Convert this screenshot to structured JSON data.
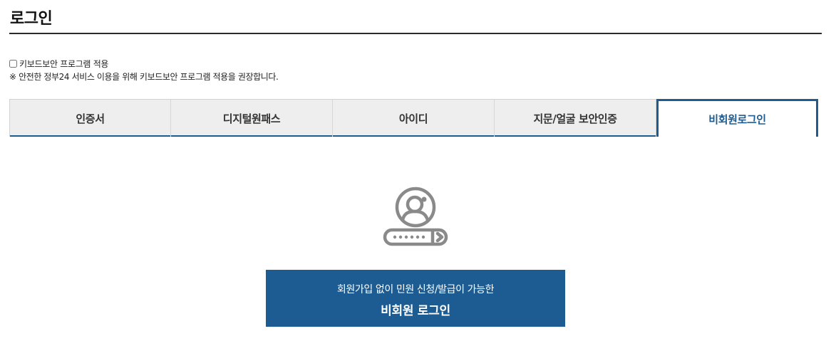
{
  "page": {
    "title": "로그인"
  },
  "keyboard_security": {
    "checkbox_label": "키보드보안 프로그램 적용",
    "checked": false,
    "notice": "※ 안전한 정부24 서비스 이용을 위해 키보드보안 프로그램 적용을 권장합니다."
  },
  "tabs": [
    {
      "label": "인증서",
      "active": false
    },
    {
      "label": "디지털원패스",
      "active": false
    },
    {
      "label": "아이디",
      "active": false
    },
    {
      "label": "지문/얼굴 보안인증",
      "active": false
    },
    {
      "label": "비회원로그인",
      "active": true
    }
  ],
  "guest": {
    "icon": "user-password-icon",
    "description": "회원가입 없이 민원 신청/발급이 가능한",
    "button_label": "비회원 로그인"
  },
  "colors": {
    "accent": "#1e5b8f",
    "button_bg": "#1d5c92",
    "tab_bg": "#eeeeee",
    "icon_gray": "#8a8a8a"
  }
}
